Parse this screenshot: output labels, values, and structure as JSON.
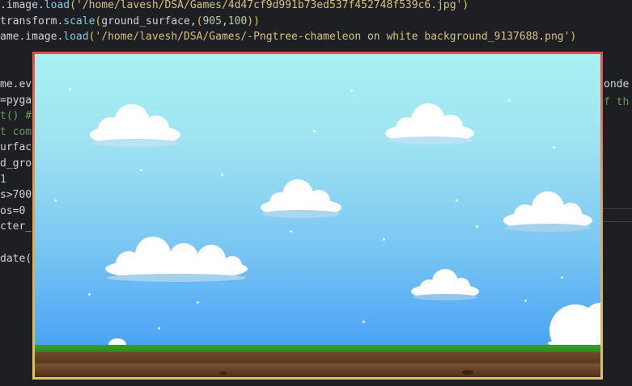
{
  "code": {
    "lines": [
      {
        "parts": [
          {
            "t": ".image.",
            "c": "plain"
          },
          {
            "t": "load",
            "c": "fn"
          },
          {
            "t": "(",
            "c": "paren"
          },
          {
            "t": "'/home/lavesh/DSA/Games/4d47cf9d991b73ed537f452748f539c6.jpg'",
            "c": "str"
          },
          {
            "t": ")",
            "c": "paren"
          }
        ]
      },
      {
        "parts": [
          {
            "t": "transform.",
            "c": "plain"
          },
          {
            "t": "scale",
            "c": "fn"
          },
          {
            "t": "(",
            "c": "paren"
          },
          {
            "t": "ground_surface,",
            "c": "plain"
          },
          {
            "t": "(",
            "c": "paren"
          },
          {
            "t": "905",
            "c": "num"
          },
          {
            "t": ",",
            "c": "plain"
          },
          {
            "t": "100",
            "c": "num"
          },
          {
            "t": "))",
            "c": "paren"
          }
        ]
      },
      {
        "parts": [
          {
            "t": "ame.image.",
            "c": "plain"
          },
          {
            "t": "load",
            "c": "fn"
          },
          {
            "t": "(",
            "c": "paren"
          },
          {
            "t": "'/home/lavesh/DSA/Games/-Pngtree-chameleon on white background_9137688.png'",
            "c": "str"
          },
          {
            "t": ")",
            "c": "paren"
          }
        ]
      },
      {
        "parts": [
          {
            "t": "",
            "c": "plain"
          }
        ]
      },
      {
        "parts": [
          {
            "t": "",
            "c": "plain"
          }
        ]
      },
      {
        "parts": [
          {
            "t": "me.ev",
            "c": "plain"
          }
        ]
      },
      {
        "parts": [
          {
            "t": "=pyga",
            "c": "plain"
          }
        ]
      },
      {
        "parts": [
          {
            "t": "t() #",
            "c": "cm"
          }
        ]
      },
      {
        "parts": [
          {
            "t": "t com",
            "c": "cm"
          }
        ]
      },
      {
        "parts": [
          {
            "t": "urfac",
            "c": "plain"
          }
        ]
      },
      {
        "parts": [
          {
            "t": "d_gro",
            "c": "plain"
          }
        ]
      },
      {
        "parts": [
          {
            "t": "1",
            "c": "num"
          }
        ]
      },
      {
        "parts": [
          {
            "t": "s>700",
            "c": "plain"
          }
        ]
      },
      {
        "parts": [
          {
            "t": "os=0",
            "c": "plain"
          }
        ]
      },
      {
        "parts": [
          {
            "t": "cter_",
            "c": "plain"
          }
        ]
      },
      {
        "parts": [
          {
            "t": "",
            "c": "plain"
          }
        ]
      },
      {
        "parts": [
          {
            "t": "date(",
            "c": "plain"
          }
        ]
      }
    ],
    "right_fragments": [
      "onde",
      "f th"
    ]
  },
  "game": {
    "window_name": "game-window",
    "sky_colors": [
      "#a8f1f1",
      "#4ba4f4"
    ],
    "grass_color": "#3aa12a",
    "dirt_color": "#6e4a2b"
  }
}
